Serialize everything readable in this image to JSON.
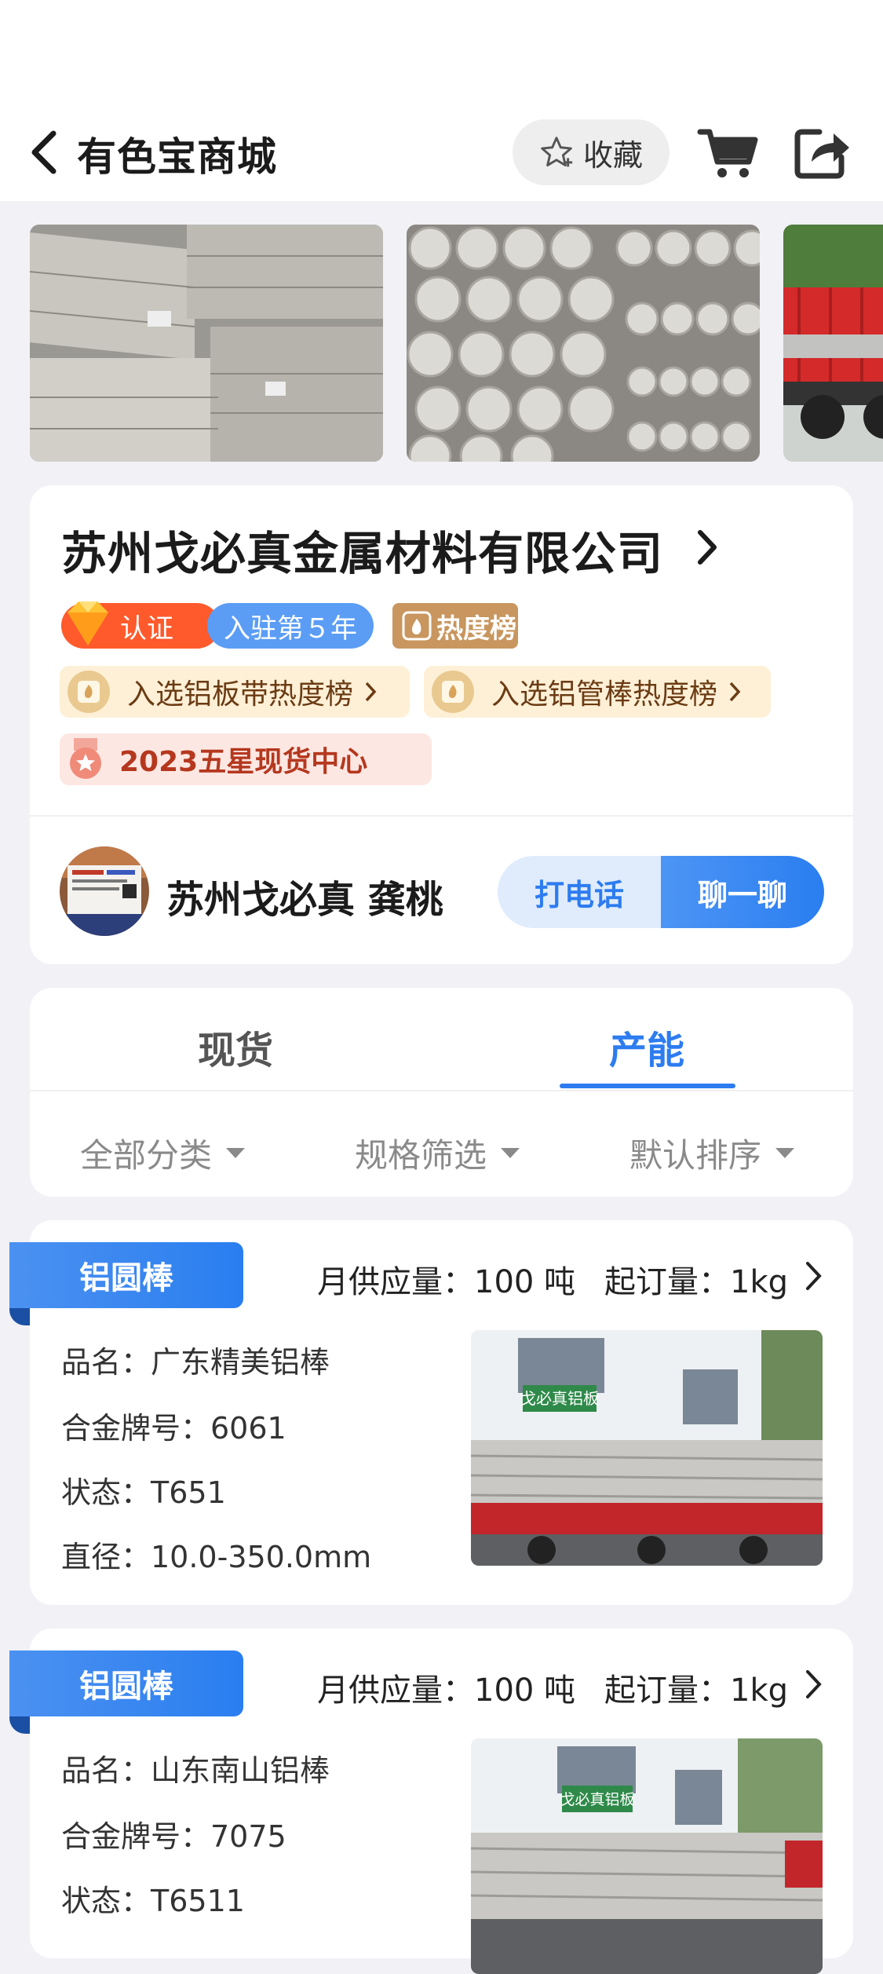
{
  "header": {
    "title": "有色宝商城",
    "favorite_label": "收藏"
  },
  "company": {
    "name": "苏州戈必真金属材料有限公司",
    "badge_certified": "认证",
    "badge_years": "入驻第５年",
    "badge_hot": "热度榜",
    "rank_items": [
      "入选铝板带热度榜",
      "入选铝管棒热度榜"
    ],
    "star_award": "2023五星现货中心",
    "contact_name": "苏州戈必真 龚桃",
    "call_label": "打电话",
    "chat_label": "聊一聊"
  },
  "tabs": {
    "items": [
      "现货",
      "产能"
    ],
    "active": "产能"
  },
  "filters": [
    "全部分类",
    "规格筛选",
    "默认排序"
  ],
  "products": [
    {
      "tag": "铝圆棒",
      "supply": "月供应量：100 吨",
      "min_order": "起订量：1kg",
      "fields": [
        "品名：广东精美铝棒",
        "合金牌号：6061",
        "状态：T651",
        "直径：10.0-350.0mm"
      ],
      "sign_text": "戈必真铝板"
    },
    {
      "tag": "铝圆棒",
      "supply": "月供应量：100 吨",
      "min_order": "起订量：1kg",
      "fields": [
        "品名：山东南山铝棒",
        "合金牌号：7075",
        "状态：T6511"
      ],
      "sign_text": "戈必真铝板"
    }
  ],
  "colors": {
    "accent": "#2d7cf0",
    "cert_badge": "#ff5a2c",
    "years_badge": "#5b9df5",
    "hot_badge": "#c8965e",
    "rank_pill_bg": "#fdf0d6",
    "star_pill_bg": "#fde7e3"
  }
}
